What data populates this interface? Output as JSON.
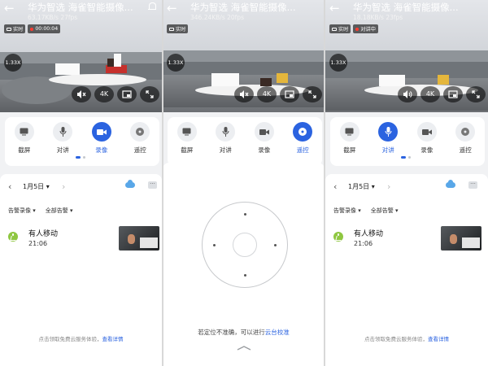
{
  "app": {
    "title": "华为智选 海雀智能摄像...",
    "accent": "#2b63e0"
  },
  "screens": [
    {
      "stats": "63.17KB/s  27fps",
      "badges": [
        "实时",
        "00:00:04"
      ],
      "zoom": "1.33X",
      "controls": [
        {
          "label": "截屏",
          "icon": "screenshot-icon"
        },
        {
          "label": "对讲",
          "icon": "microphone-icon"
        },
        {
          "label": "录像",
          "icon": "video-camera-icon",
          "active": true
        },
        {
          "label": "遥控",
          "icon": "dpad-icon"
        }
      ],
      "date": "1月5日",
      "filters": [
        "告警录像",
        "全部告警"
      ],
      "event": {
        "title": "有人移动",
        "time": "21:06"
      },
      "promo_text": "点击领取免费云服务体验，",
      "promo_link": "查看详情"
    },
    {
      "stats": "346.24KB/s  20fps",
      "badges": [
        "实时"
      ],
      "zoom": "1.33X",
      "controls": [
        {
          "label": "截屏",
          "icon": "screenshot-icon"
        },
        {
          "label": "对讲",
          "icon": "microphone-icon"
        },
        {
          "label": "录像",
          "icon": "video-camera-icon"
        },
        {
          "label": "遥控",
          "icon": "dpad-icon",
          "active": true
        }
      ],
      "remote_hint": "若定位不准确，可以进行",
      "remote_link": "云台校准"
    },
    {
      "stats": "18.18KB/s  23fps",
      "badges": [
        "实时",
        "对讲中"
      ],
      "zoom": "1.33X",
      "controls": [
        {
          "label": "截屏",
          "icon": "screenshot-icon"
        },
        {
          "label": "对讲",
          "icon": "microphone-icon",
          "active": true
        },
        {
          "label": "录像",
          "icon": "video-camera-icon"
        },
        {
          "label": "遥控",
          "icon": "dpad-icon"
        }
      ],
      "date": "1月5日",
      "filters": [
        "告警录像",
        "全部告警"
      ],
      "event": {
        "title": "有人移动",
        "time": "21:06"
      },
      "promo_text": "点击领取免费云服务体验，",
      "promo_link": "查看详情"
    }
  ],
  "video_buttons": {
    "quality": "4K"
  }
}
